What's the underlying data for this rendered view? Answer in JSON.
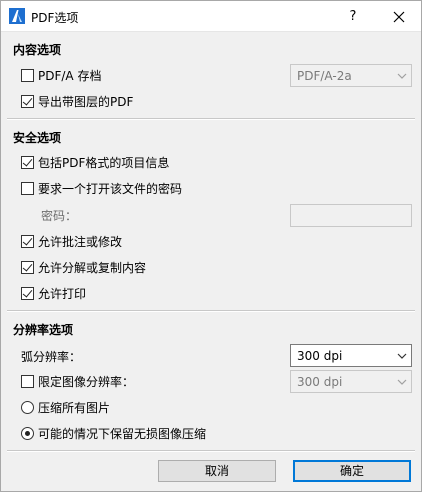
{
  "window": {
    "title": "PDF选项",
    "help_label": "?",
    "app_icon": "archicad-icon",
    "close_icon": "close-icon"
  },
  "content": {
    "section_title": "内容选项",
    "pdfa_archive": {
      "label": "PDF/A 存档",
      "checked": false
    },
    "pdfa_version": {
      "value": "PDF/A-2a",
      "enabled": false
    },
    "export_layers": {
      "label": "导出带图层的PDF",
      "checked": true
    }
  },
  "security": {
    "section_title": "安全选项",
    "include_project_info": {
      "label": "包括PDF格式的项目信息",
      "checked": true
    },
    "require_password": {
      "label": "要求一个打开该文件的密码",
      "checked": false
    },
    "password_label": "密码：",
    "password_value": "",
    "allow_annotate": {
      "label": "允许批注或修改",
      "checked": true
    },
    "allow_copy": {
      "label": "允许分解或复制内容",
      "checked": true
    },
    "allow_print": {
      "label": "允许打印",
      "checked": true
    }
  },
  "resolution": {
    "section_title": "分辨率选项",
    "arc_resolution_label": "弧分辨率：",
    "arc_resolution_value": "300 dpi",
    "limit_image_resolution": {
      "label": "限定图像分辨率：",
      "checked": false
    },
    "image_resolution_value": "300 dpi",
    "compress_all": {
      "label": "压缩所有图片",
      "selected": false
    },
    "lossless_when_possible": {
      "label": "可能的情况下保留无损图像压缩",
      "selected": true
    }
  },
  "footer": {
    "cancel_label": "取消",
    "ok_label": "确定"
  },
  "colors": {
    "background": "#f0f0f0",
    "primary_button_border": "#0078d7",
    "disabled_text": "#7a7a7a"
  }
}
